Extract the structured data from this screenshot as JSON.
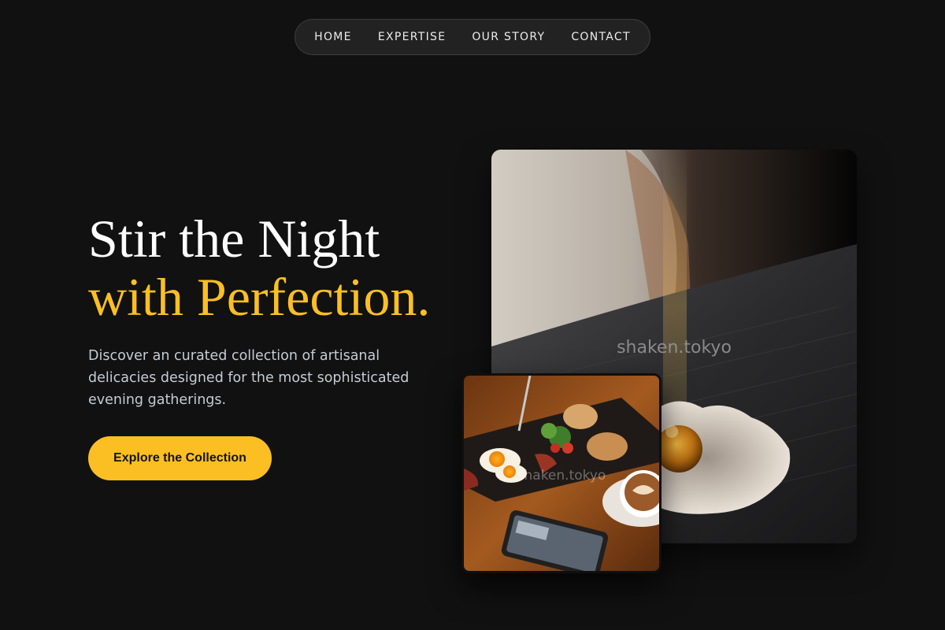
{
  "nav": {
    "items": [
      {
        "label": "HOME"
      },
      {
        "label": "EXPERTISE"
      },
      {
        "label": "OUR STORY"
      },
      {
        "label": "CONTACT"
      }
    ]
  },
  "hero": {
    "title_line1": "Stir the Night",
    "title_line2": "with Perfection.",
    "description": "Discover an curated collection of artisanal delicacies designed for the most sophisticated evening gatherings.",
    "cta_label": "Explore the Collection"
  },
  "images": {
    "main_watermark": "shaken.tokyo",
    "small_watermark": "shaken.tokyo"
  },
  "colors": {
    "background": "#111111",
    "accent": "#fbbf24",
    "nav_bg": "#222222",
    "text_primary": "#ffffff",
    "text_secondary": "#c8cbd4"
  }
}
